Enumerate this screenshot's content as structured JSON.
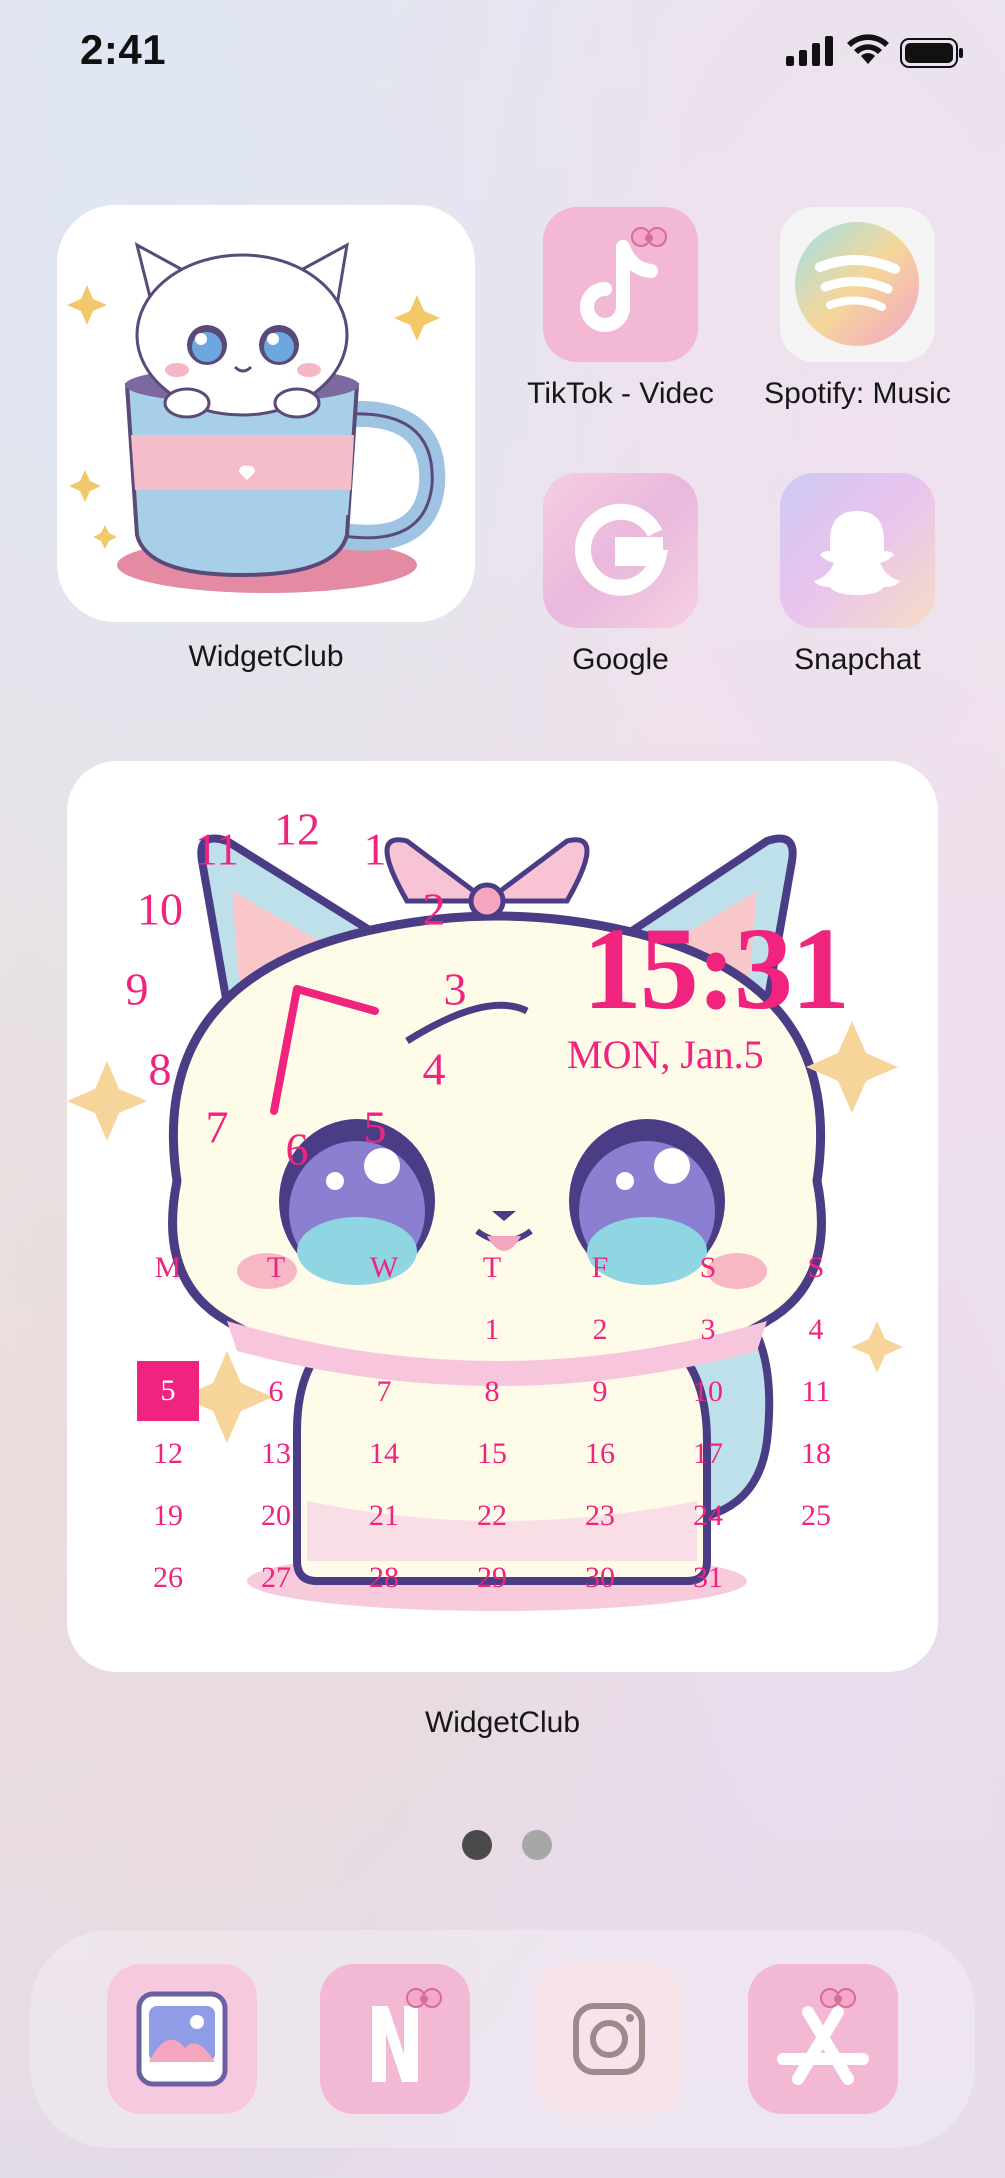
{
  "status_bar": {
    "time": "2:41",
    "signal_icon": "cellular-signal-icon",
    "wifi_icon": "wifi-icon",
    "battery_icon": "battery-icon"
  },
  "home": {
    "large_widget": {
      "label": "WidgetClub",
      "image": "kitten-in-teacup-illustration"
    },
    "apps": [
      {
        "label": "TikTok - Videc",
        "icon": "tiktok-icon",
        "color": "#f2b8d4"
      },
      {
        "label": "Spotify: Music",
        "icon": "spotify-icon",
        "color": "#f4f4f4"
      },
      {
        "label": "Google",
        "icon": "google-icon",
        "color": "#f3c4dc"
      },
      {
        "label": "Snapchat",
        "icon": "snapchat-icon",
        "color": "#e7ccf1"
      }
    ],
    "calendar_widget": {
      "label": "WidgetClub",
      "digital_time": "15:31",
      "date": "MON, Jan.5",
      "clock_numbers": [
        "12",
        "1",
        "2",
        "3",
        "4",
        "5",
        "6",
        "7",
        "8",
        "9",
        "10",
        "11"
      ],
      "weekday_headers": [
        "M",
        "T",
        "W",
        "T",
        "F",
        "S",
        "S"
      ],
      "weeks": [
        [
          "",
          "",
          "",
          "1",
          "2",
          "3",
          "4"
        ],
        [
          "5",
          "6",
          "7",
          "8",
          "9",
          "10",
          "11"
        ],
        [
          "12",
          "13",
          "14",
          "15",
          "16",
          "17",
          "18"
        ],
        [
          "19",
          "20",
          "21",
          "22",
          "23",
          "24",
          "25"
        ],
        [
          "26",
          "27",
          "28",
          "29",
          "30",
          "31",
          ""
        ]
      ],
      "today": "5",
      "accent_color": "#f0237e",
      "image": "kawaii-cat-with-bow-illustration"
    },
    "page_indicator": {
      "pages": 2,
      "current": 1
    }
  },
  "dock": [
    {
      "icon": "photos-icon"
    },
    {
      "icon": "netflix-icon"
    },
    {
      "icon": "instagram-icon"
    },
    {
      "icon": "app-store-icon"
    }
  ]
}
